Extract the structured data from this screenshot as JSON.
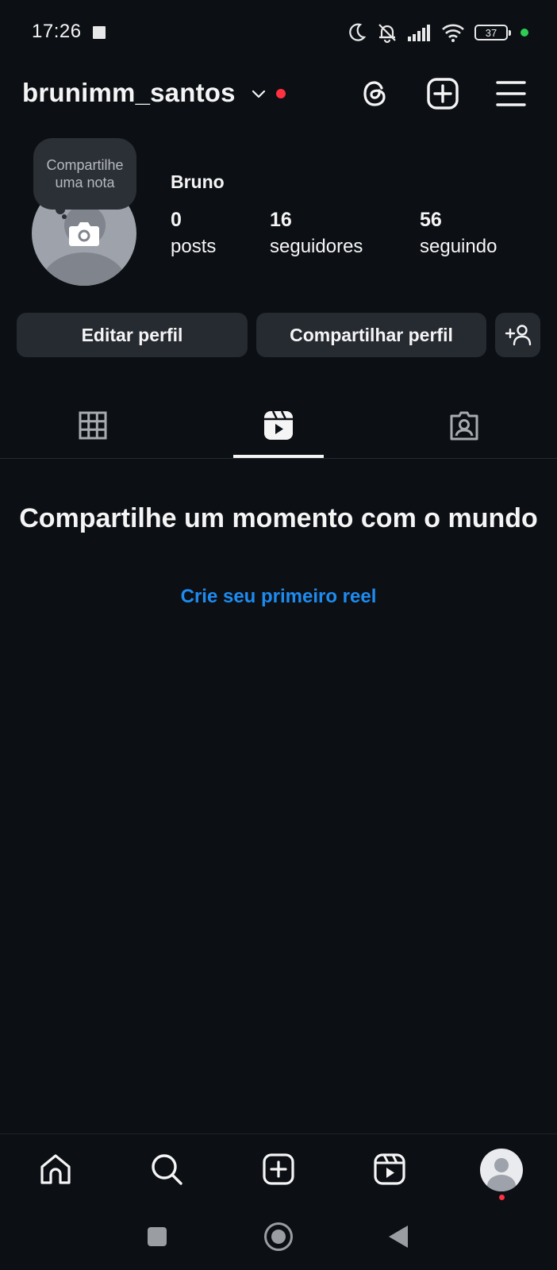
{
  "status_bar": {
    "time": "17:26",
    "battery": "37",
    "icons": [
      "moon-icon",
      "bell-off-icon",
      "signal-icon",
      "wifi-icon",
      "battery-icon"
    ]
  },
  "header": {
    "username": "brunimm_santos",
    "icons": [
      "chevron-down-icon",
      "threads-icon",
      "add-post-icon",
      "menu-icon"
    ]
  },
  "profile": {
    "note_text": "Compartilhe uma nota",
    "display_name": "Bruno",
    "stats": [
      {
        "value": "0",
        "label": "posts"
      },
      {
        "value": "16",
        "label": "seguidores"
      },
      {
        "value": "56",
        "label": "seguindo"
      }
    ]
  },
  "actions": {
    "edit_label": "Editar perfil",
    "share_label": "Compartilhar perfil"
  },
  "tabs": {
    "items": [
      "grid-icon",
      "reels-icon",
      "tagged-icon"
    ],
    "active": 1
  },
  "empty_state": {
    "title": "Compartilhe um momento com o mundo",
    "link": "Crie seu primeiro reel"
  },
  "bottom_nav": {
    "items": [
      "home-icon",
      "search-icon",
      "create-icon",
      "reels-icon",
      "profile-avatar"
    ]
  },
  "colors": {
    "background": "#0c0f14",
    "button_bg": "#262a31",
    "link": "#1d8cf0",
    "notification_dot": "#ff3040"
  }
}
